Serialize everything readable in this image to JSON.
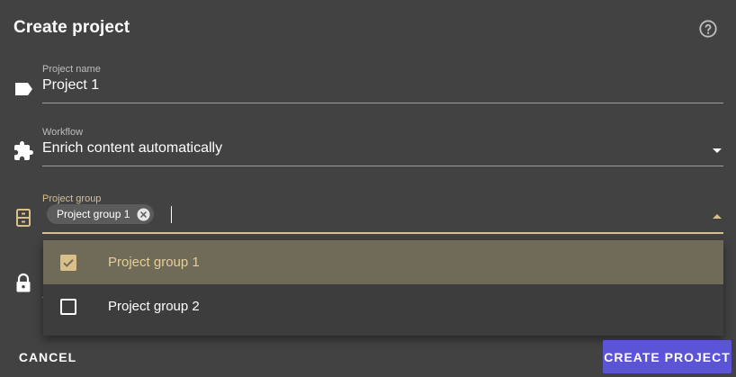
{
  "dialog": {
    "title": "Create project",
    "help_icon": "help-circle-icon"
  },
  "fields": {
    "project_name": {
      "label": "Project name",
      "value": "Project 1",
      "icon": "label-tag-icon"
    },
    "workflow": {
      "label": "Workflow",
      "value": "Enrich content automatically",
      "icon": "puzzle-piece-icon"
    },
    "project_group": {
      "label": "Project group",
      "chips": [
        "Project group 1"
      ],
      "icon": "cabinet-icon",
      "options": [
        {
          "label": "Project group 1",
          "checked": true
        },
        {
          "label": "Project group 2",
          "checked": false
        }
      ]
    },
    "hidden_field": {
      "icon": "lock-icon"
    }
  },
  "actions": {
    "cancel_label": "CANCEL",
    "create_label": "CREATE PROJECT"
  },
  "colors": {
    "background": "#424242",
    "accent": "#d9c08a",
    "primary_button": "#5c54d6",
    "selected_option": "#706a59"
  }
}
